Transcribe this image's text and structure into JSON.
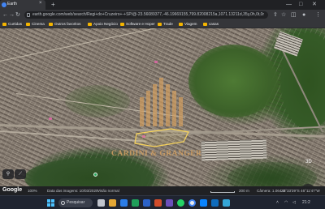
{
  "browser": {
    "tab_title": "Earth",
    "tab_close": "×",
    "new_tab": "+",
    "url": "earth.google.com/web/search/Regi+do+Cruzeiro+-+SP/@-23.56089377,-46.19669155,799.82008215a,1071.13211d,35y,0h,0t,0r/data=CigiJggKE",
    "bookmarks": [
      {
        "label": "Curtidas",
        "color": "#f4b400"
      },
      {
        "label": "Cinema",
        "color": "#f4b400"
      },
      {
        "label": "Outros favoritos",
        "color": "#f4b400"
      },
      {
        "label": "Apoio Negócio",
        "color": "#f4b400"
      },
      {
        "label": "Software e Hoper",
        "color": "#f4b400"
      },
      {
        "label": "Trade",
        "color": "#f4b400"
      },
      {
        "label": "Viagem",
        "color": "#f4b400"
      },
      {
        "label": "casas",
        "color": "#f4b400"
      }
    ]
  },
  "map": {
    "watermark": "CARDINI & GRANGER",
    "zoom_in": "+",
    "zoom_out": "−",
    "compass": "N",
    "view_3d": "3D"
  },
  "statusbar": {
    "brand": "Google",
    "zoom_level": "100%",
    "imagery_date": "Data das imagens: 10/03/2020",
    "view_mode": "Visão normal",
    "scale": "200 m",
    "camera": "Câmera: 1.064 m",
    "coordinates": "23°33'39\"S 46°11'47\"W"
  },
  "taskbar": {
    "search_label": "Pesquisar",
    "time": "21:2"
  }
}
